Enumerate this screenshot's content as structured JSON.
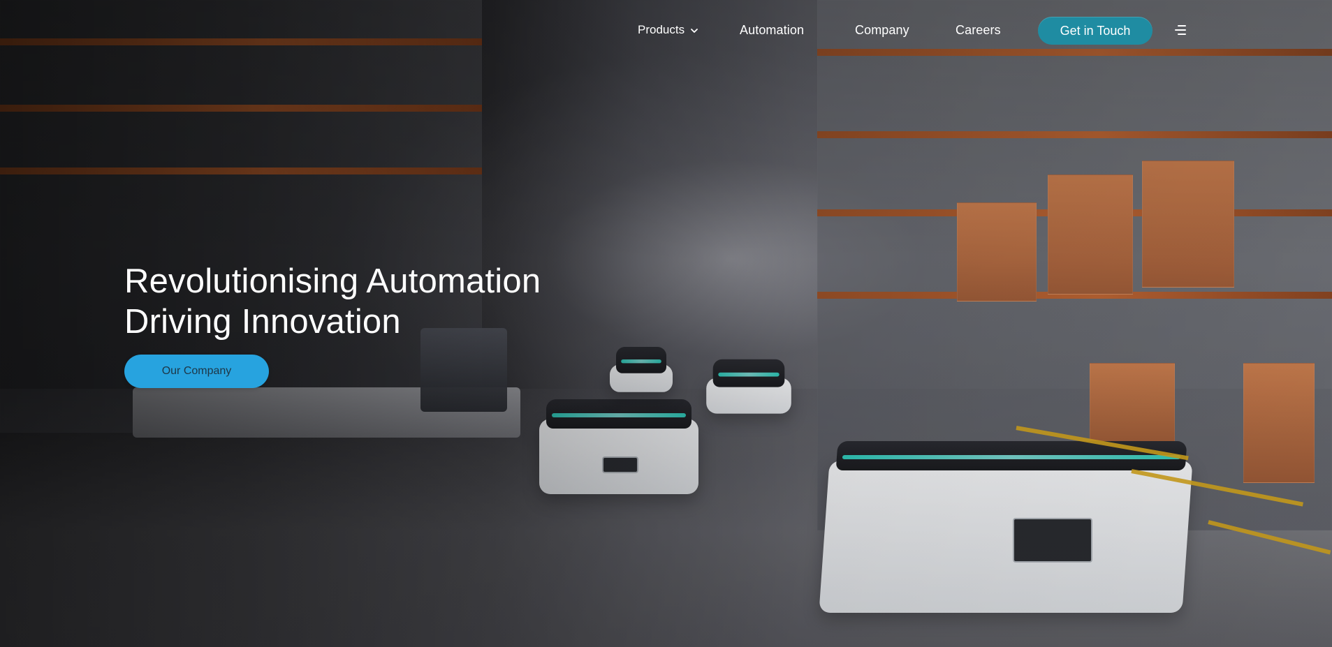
{
  "navigation": {
    "products_label": "Products",
    "automation_label": "Automation",
    "company_label": "Company",
    "careers_label": "Careers",
    "contact_button_label": "Get in Touch",
    "menu_icon": "menu-icon",
    "dropdown_icon": "chevron-down-icon"
  },
  "hero": {
    "headline_line1": "Revolutionising Automation",
    "headline_line2": "Driving Innovation",
    "cta_label": "Our Company"
  },
  "colors": {
    "primary_accent": "#27a3df",
    "secondary_accent": "#1f8ca2",
    "text_primary": "#ffffff",
    "cta_text": "#1e3646"
  }
}
